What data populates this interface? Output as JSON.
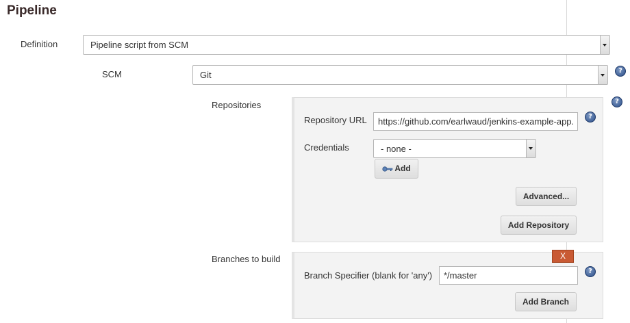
{
  "section": {
    "title": "Pipeline"
  },
  "definition": {
    "label": "Definition",
    "value": "Pipeline script from SCM"
  },
  "scm": {
    "label": "SCM",
    "value": "Git",
    "help_glyph": "?"
  },
  "repositories": {
    "label": "Repositories",
    "help_glyph": "?",
    "repository_url": {
      "label": "Repository URL",
      "value": "https://github.com/earlwaud/jenkins-example-app.",
      "help_glyph": "?"
    },
    "credentials": {
      "label": "Credentials",
      "value": "- none -",
      "add_label": "Add",
      "add_icon": "key-icon"
    },
    "advanced_label": "Advanced...",
    "add_repository_label": "Add Repository"
  },
  "branches": {
    "label": "Branches to build",
    "delete_label": "X",
    "specifier": {
      "label": "Branch Specifier (blank for 'any')",
      "value": "*/master",
      "help_glyph": "?"
    },
    "add_branch_label": "Add Branch"
  },
  "colors": {
    "delete_button": "#c95a34",
    "help_icon": "#2c4f8a",
    "panel_bg": "#f3f3f3"
  }
}
